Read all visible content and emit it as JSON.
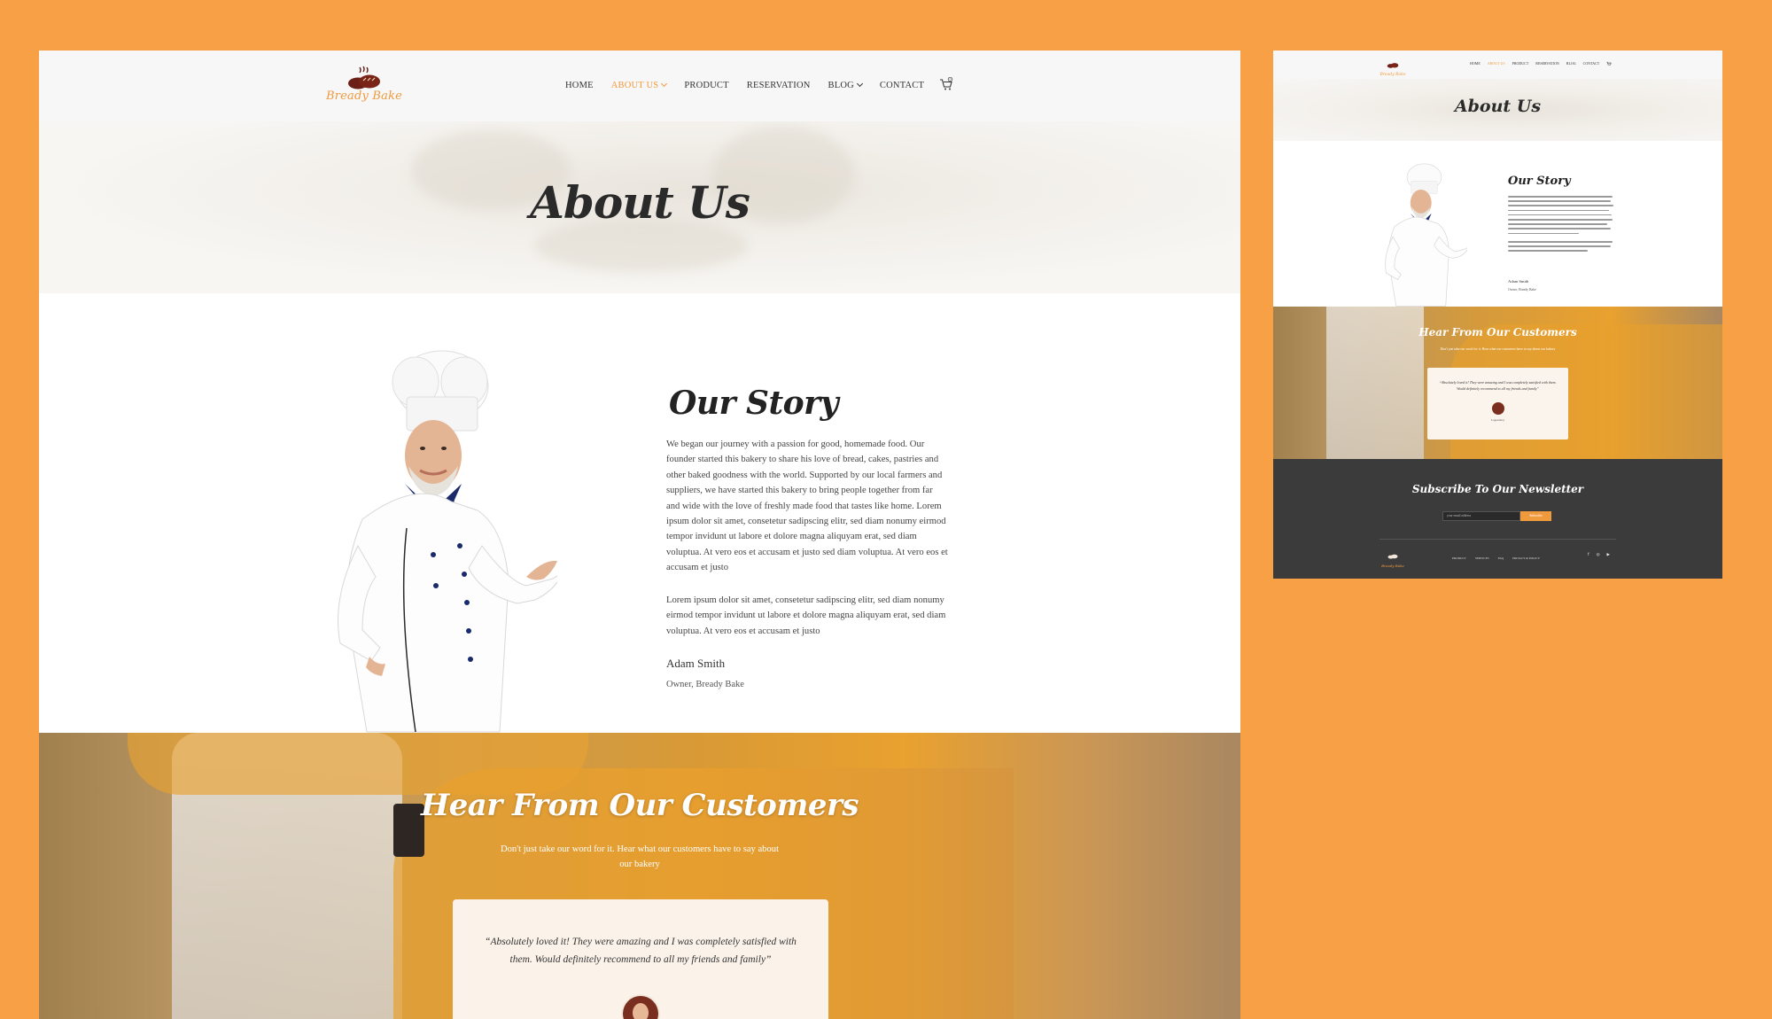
{
  "brand": {
    "name": "Bready Bake",
    "accent": "#F09A3E",
    "background": "#F8A045"
  },
  "nav": {
    "items": [
      {
        "label": "HOME",
        "active": false,
        "dropdown": false
      },
      {
        "label": "ABOUT US",
        "active": true,
        "dropdown": true
      },
      {
        "label": "PRODUCT",
        "active": false,
        "dropdown": false
      },
      {
        "label": "RESERVATION",
        "active": false,
        "dropdown": false
      },
      {
        "label": "BLOG",
        "active": false,
        "dropdown": true
      },
      {
        "label": "CONTACT",
        "active": false,
        "dropdown": false
      }
    ],
    "cart_icon": "cart-icon",
    "cart_count": "0"
  },
  "hero": {
    "title": "About Us"
  },
  "story": {
    "title": "Our Story",
    "paragraph1": "We began our journey with a passion for good, homemade food. Our founder started this bakery to share his love of bread, cakes, pastries and other baked goodness with the world. Supported by our local farmers and suppliers, we have started this bakery to bring people together from far and wide with the love of freshly made food that tastes like home. Lorem ipsum dolor sit amet, consetetur sadipscing elitr, sed diam nonumy eirmod tempor invidunt ut labore et dolore magna aliquyam erat, sed diam voluptua. At vero eos et accusam et justo sed diam voluptua. At vero eos et accusam et justo",
    "paragraph2": "Lorem ipsum dolor sit amet, consetetur sadipscing elitr, sed diam nonumy eirmod tempor invidunt ut labore et dolore magna aliquyam erat, sed diam voluptua. At vero eos et accusam et justo",
    "author_name": "Adam Smith",
    "author_role": "Owner, Bready Bake"
  },
  "testimonials": {
    "title": "Hear From Our Customers",
    "subtitle": "Don't just take our word for it. Hear what our customers have to say about our bakery",
    "quote": "“Absolutely loved it! They were amazing and I was completely satisfied with them. Would definitely recommend to all my friends and family”",
    "customer_name": "Logan Roy"
  },
  "newsletter": {
    "title": "Subscribe To Our Newsletter",
    "email_placeholder": "your email address",
    "button_label": "Subscribe"
  },
  "footer": {
    "links": [
      "PRODUCT",
      "SERVICES",
      "FAQ",
      "PRIVACY & POLICY"
    ],
    "social_icons": [
      "facebook-icon",
      "instagram-icon",
      "youtube-icon"
    ]
  }
}
